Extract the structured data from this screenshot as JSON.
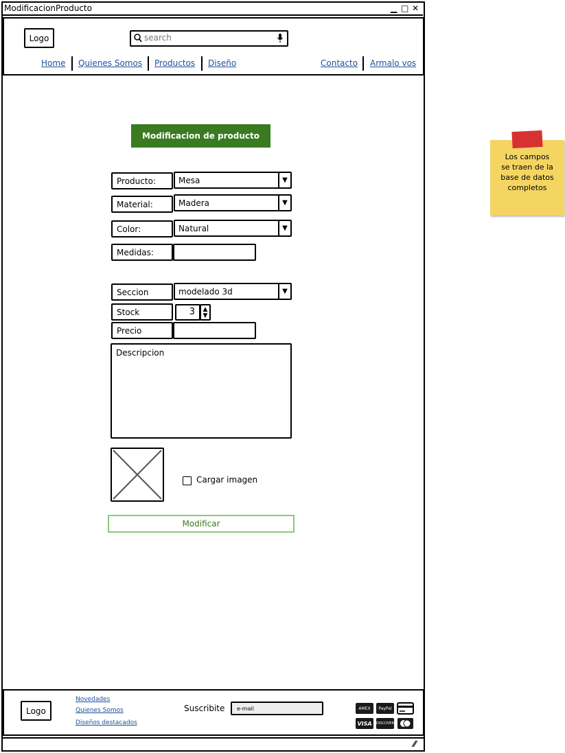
{
  "window": {
    "title": "ModificacionProducto",
    "min_glyph": "▁",
    "max_glyph": "□",
    "close_glyph": "✕"
  },
  "header": {
    "logo": "Logo",
    "search_placeholder": "search",
    "nav": [
      "Home",
      "Quienes Somos",
      "Productos",
      "Diseño",
      "Contacto",
      "Armalo vos"
    ]
  },
  "form": {
    "title": "Modificacion de producto",
    "producto": {
      "label": "Producto:",
      "value": "Mesa"
    },
    "material": {
      "label": "Material:",
      "value": "Madera"
    },
    "color": {
      "label": "Color:",
      "value": "Natural"
    },
    "medidas": {
      "label": "Medidas:",
      "value": ""
    },
    "seccion": {
      "label": "Seccion",
      "value": "modelado 3d"
    },
    "stock": {
      "label": "Stock",
      "value": "3"
    },
    "precio": {
      "label": "Precio",
      "value": ""
    },
    "descripcion": {
      "placeholder": "Descripcion"
    },
    "cargar_imagen": "Cargar imagen",
    "submit": "Modificar"
  },
  "note": {
    "line1": "Los campos",
    "line2": "se traen de la",
    "line3": "base de datos",
    "line4": "completos"
  },
  "footer": {
    "logo": "Logo",
    "links": [
      "Novedades",
      "Quienes Somos",
      "Diseños destacados"
    ],
    "suscribe": "Suscribite",
    "email_placeholder": "e-mail",
    "payments": [
      "AMEX",
      "PayPal",
      "Card",
      "VISA",
      "DISCOVER",
      "MasterCard"
    ]
  },
  "colors": {
    "accent_green": "#3a7a20",
    "button_border": "#8cc77a",
    "link": "#1c4f9c",
    "note": "#f5d562",
    "note_tape": "#d73232"
  }
}
